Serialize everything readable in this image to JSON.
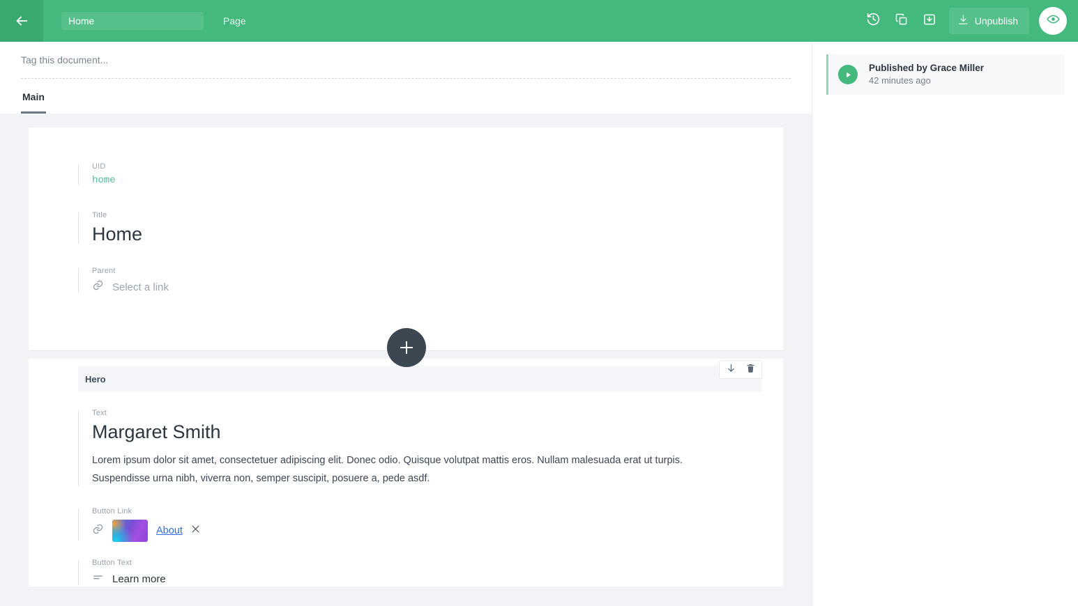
{
  "topbar": {
    "back_icon": "arrow-left-icon",
    "document_name": "Home",
    "document_type": "Page",
    "history_icon": "history-icon",
    "duplicate_icon": "duplicate-icon",
    "save_icon": "save-box-icon",
    "unpublish_icon": "download-icon",
    "unpublish_label": "Unpublish",
    "preview_icon": "eye-icon",
    "green": "#43b97d"
  },
  "editor": {
    "tag_placeholder": "Tag this document...",
    "tabs": [
      {
        "label": "Main",
        "active": true
      }
    ],
    "document_fields": [
      {
        "label": "UID",
        "value": "home",
        "type": "uid"
      },
      {
        "label": "Title",
        "value": "Home",
        "type": "title"
      },
      {
        "label": "Parent",
        "placeholder": "Select a link",
        "type": "link",
        "icon": "link-icon"
      }
    ],
    "add_slice_icon": "plus-icon",
    "slice": {
      "title": "Hero",
      "move_down_icon": "arrow-down-icon",
      "delete_icon": "trash-icon",
      "fields": {
        "text_label": "Text",
        "text_heading": "Margaret Smith",
        "text_paragraph_1": "Lorem ipsum dolor sit amet, consectetuer adipiscing elit. Donec odio. Quisque volutpat mattis eros. Nullam malesuada erat ut turpis.",
        "text_paragraph_2": "Suspendisse urna nibh, viverra non, semper suscipit, posuere a, pede asdf.",
        "button_link_label": "Button Link",
        "button_link_icon": "link-icon",
        "button_link_value": "About",
        "button_link_remove_icon": "close-icon",
        "button_text_label": "Button Text",
        "button_text_icon": "text-lines-icon",
        "button_text_value": "Learn more"
      }
    }
  },
  "sidebar": {
    "status": {
      "icon": "play-circle-icon",
      "title": "Published by Grace Miller",
      "subtitle": "42 minutes ago",
      "accent": "#44b97e"
    }
  }
}
